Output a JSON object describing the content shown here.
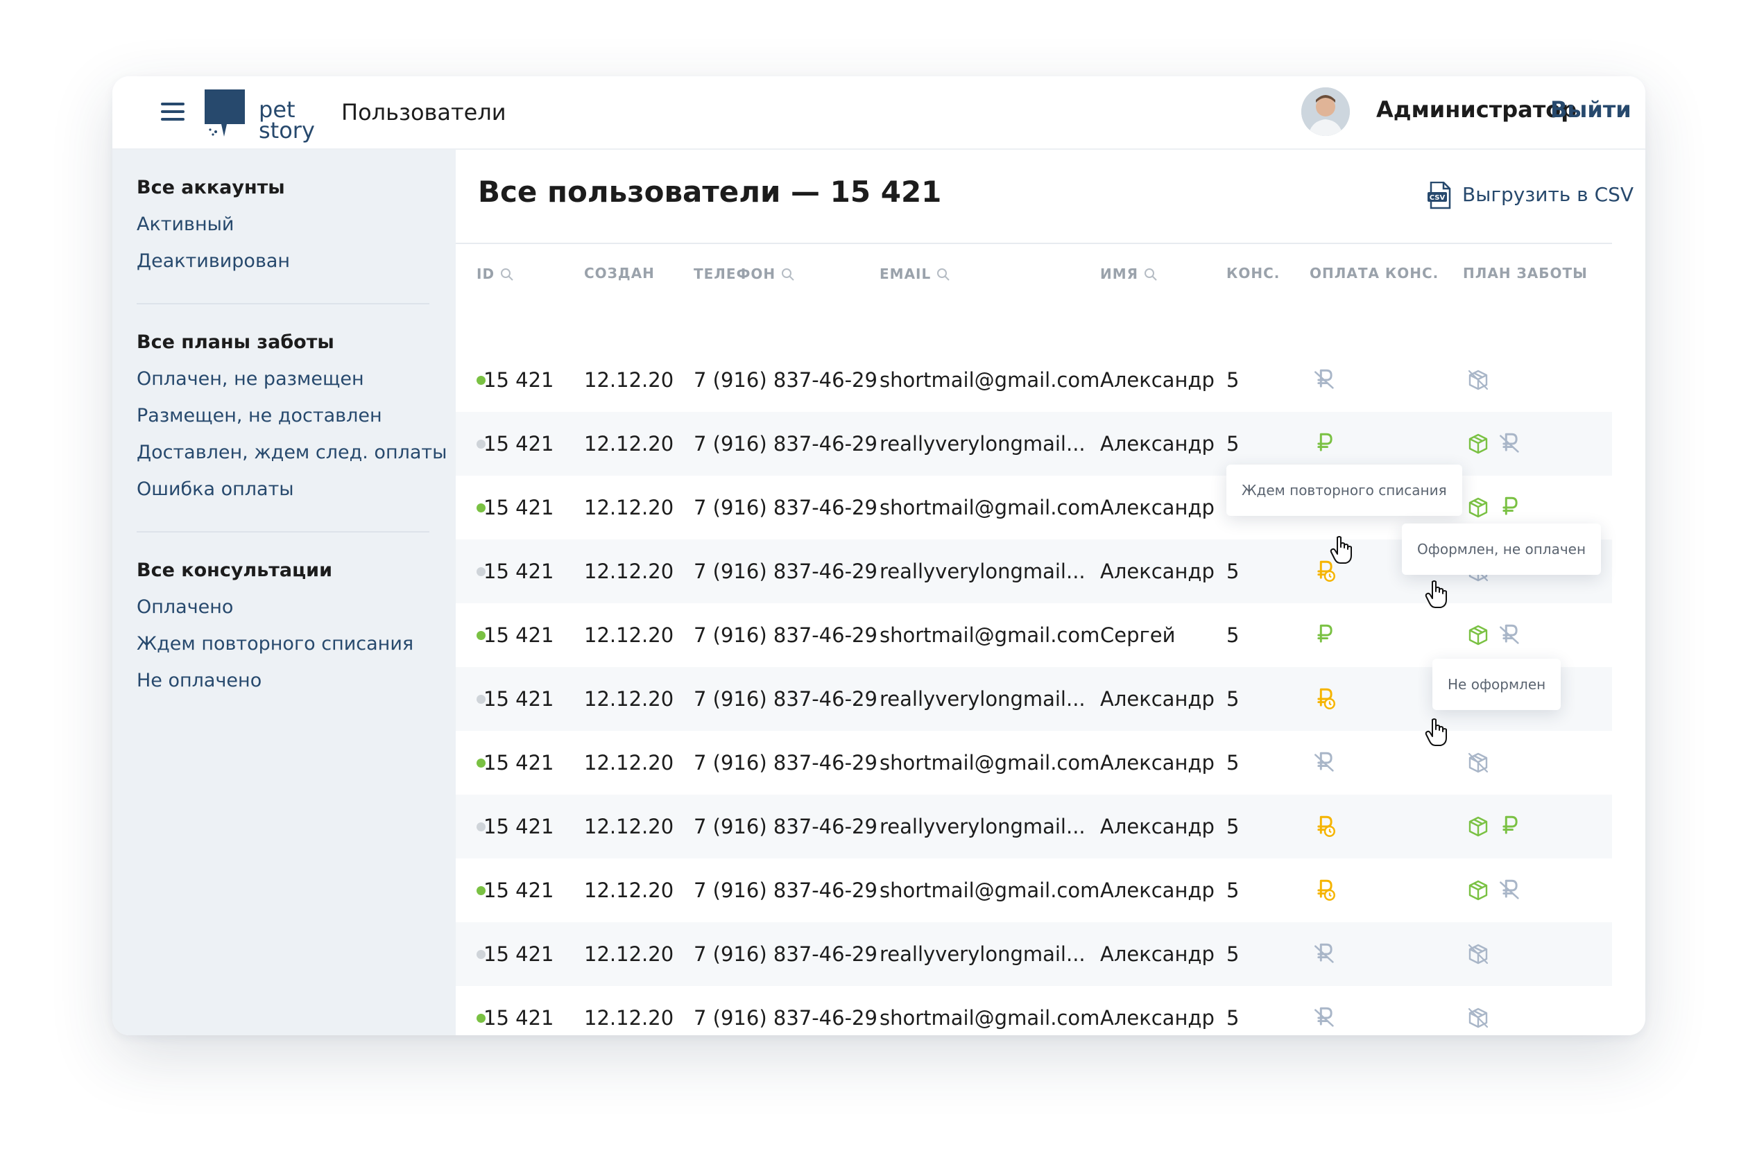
{
  "header": {
    "menu_icon": "hamburger-icon",
    "logo_text_1": "pet",
    "logo_text_2": "story",
    "page_title": "Пользователи",
    "admin_name": "Администратор",
    "logout_label": "Выйти"
  },
  "sidebar": {
    "groups": [
      {
        "title": "Все аккаунты",
        "items": [
          "Активный",
          "Деактивирован"
        ]
      },
      {
        "title": "Все планы заботы",
        "items": [
          "Оплачен, не размещен",
          "Размещен, не доставлен",
          "Доставлен, ждем след. оплаты",
          "Ошибка оплаты"
        ]
      },
      {
        "title": "Все консультации",
        "items": [
          "Оплачено",
          "Ждем повторного списания",
          "Не оплачено"
        ]
      }
    ]
  },
  "main": {
    "title": "Все пользователи — 15 421",
    "csv_label": "Выгрузить в CSV",
    "columns": [
      "ID",
      "СОЗДАН",
      "ТЕЛЕФОН",
      "EMAIL",
      "ИМЯ",
      "КОНС.",
      "ОПЛАТА КОНС.",
      "ПЛАН ЗАБОТЫ"
    ]
  },
  "colors": {
    "brand": "#27496d",
    "active": "#7ac143",
    "inactive": "#cfd4d9",
    "paid": "#7ac143",
    "pending": "#f5b400",
    "none": "#a9b6c8"
  },
  "rows": [
    {
      "status": "active",
      "id": "15 421",
      "created": "12.12.20",
      "phone": "7 (916) 837-46-29",
      "email": "shortmail@gmail.com",
      "name": "Александр",
      "cons": "5",
      "payment": "none",
      "plan": [
        "none"
      ]
    },
    {
      "status": "inactive",
      "id": "15 421",
      "created": "12.12.20",
      "phone": "7 (916) 837-46-29",
      "email": "reallyverylongmail...",
      "name": "Александр",
      "cons": "5",
      "payment": "paid",
      "plan": [
        "box",
        "none-rub"
      ]
    },
    {
      "status": "active",
      "id": "15 421",
      "created": "12.12.20",
      "phone": "7 (916) 837-46-29",
      "email": "shortmail@gmail.com",
      "name": "Александр",
      "cons": "5",
      "payment": "paid",
      "plan": [
        "box",
        "paid-rub"
      ]
    },
    {
      "status": "inactive",
      "id": "15 421",
      "created": "12.12.20",
      "phone": "7 (916) 837-46-29",
      "email": "reallyverylongmail...",
      "name": "Александр",
      "cons": "5",
      "payment": "pending",
      "plan": [
        "none"
      ]
    },
    {
      "status": "active",
      "id": "15 421",
      "created": "12.12.20",
      "phone": "7 (916) 837-46-29",
      "email": "shortmail@gmail.com",
      "name": "Сергей",
      "cons": "5",
      "payment": "paid",
      "plan": [
        "box",
        "none-rub"
      ]
    },
    {
      "status": "inactive",
      "id": "15 421",
      "created": "12.12.20",
      "phone": "7 (916) 837-46-29",
      "email": "reallyverylongmail...",
      "name": "Александр",
      "cons": "5",
      "payment": "pending",
      "plan": [
        "none"
      ]
    },
    {
      "status": "active",
      "id": "15 421",
      "created": "12.12.20",
      "phone": "7 (916) 837-46-29",
      "email": "shortmail@gmail.com",
      "name": "Александр",
      "cons": "5",
      "payment": "none",
      "plan": [
        "none"
      ]
    },
    {
      "status": "inactive",
      "id": "15 421",
      "created": "12.12.20",
      "phone": "7 (916) 837-46-29",
      "email": "reallyverylongmail...",
      "name": "Александр",
      "cons": "5",
      "payment": "pending",
      "plan": [
        "box",
        "paid-rub"
      ]
    },
    {
      "status": "active",
      "id": "15 421",
      "created": "12.12.20",
      "phone": "7 (916) 837-46-29",
      "email": "shortmail@gmail.com",
      "name": "Александр",
      "cons": "5",
      "payment": "pending",
      "plan": [
        "box",
        "none-rub"
      ]
    },
    {
      "status": "inactive",
      "id": "15 421",
      "created": "12.12.20",
      "phone": "7 (916) 837-46-29",
      "email": "reallyverylongmail...",
      "name": "Александр",
      "cons": "5",
      "payment": "none",
      "plan": [
        "none"
      ]
    },
    {
      "status": "active",
      "id": "15 421",
      "created": "12.12.20",
      "phone": "7 (916) 837-46-29",
      "email": "shortmail@gmail.com",
      "name": "Александр",
      "cons": "5",
      "payment": "none",
      "plan": [
        "none"
      ]
    }
  ],
  "tooltips": {
    "payment_pending": "Ждем повторного списания",
    "plan_unpaid": "Оформлен, не оплачен",
    "plan_none": "Не оформлен"
  }
}
